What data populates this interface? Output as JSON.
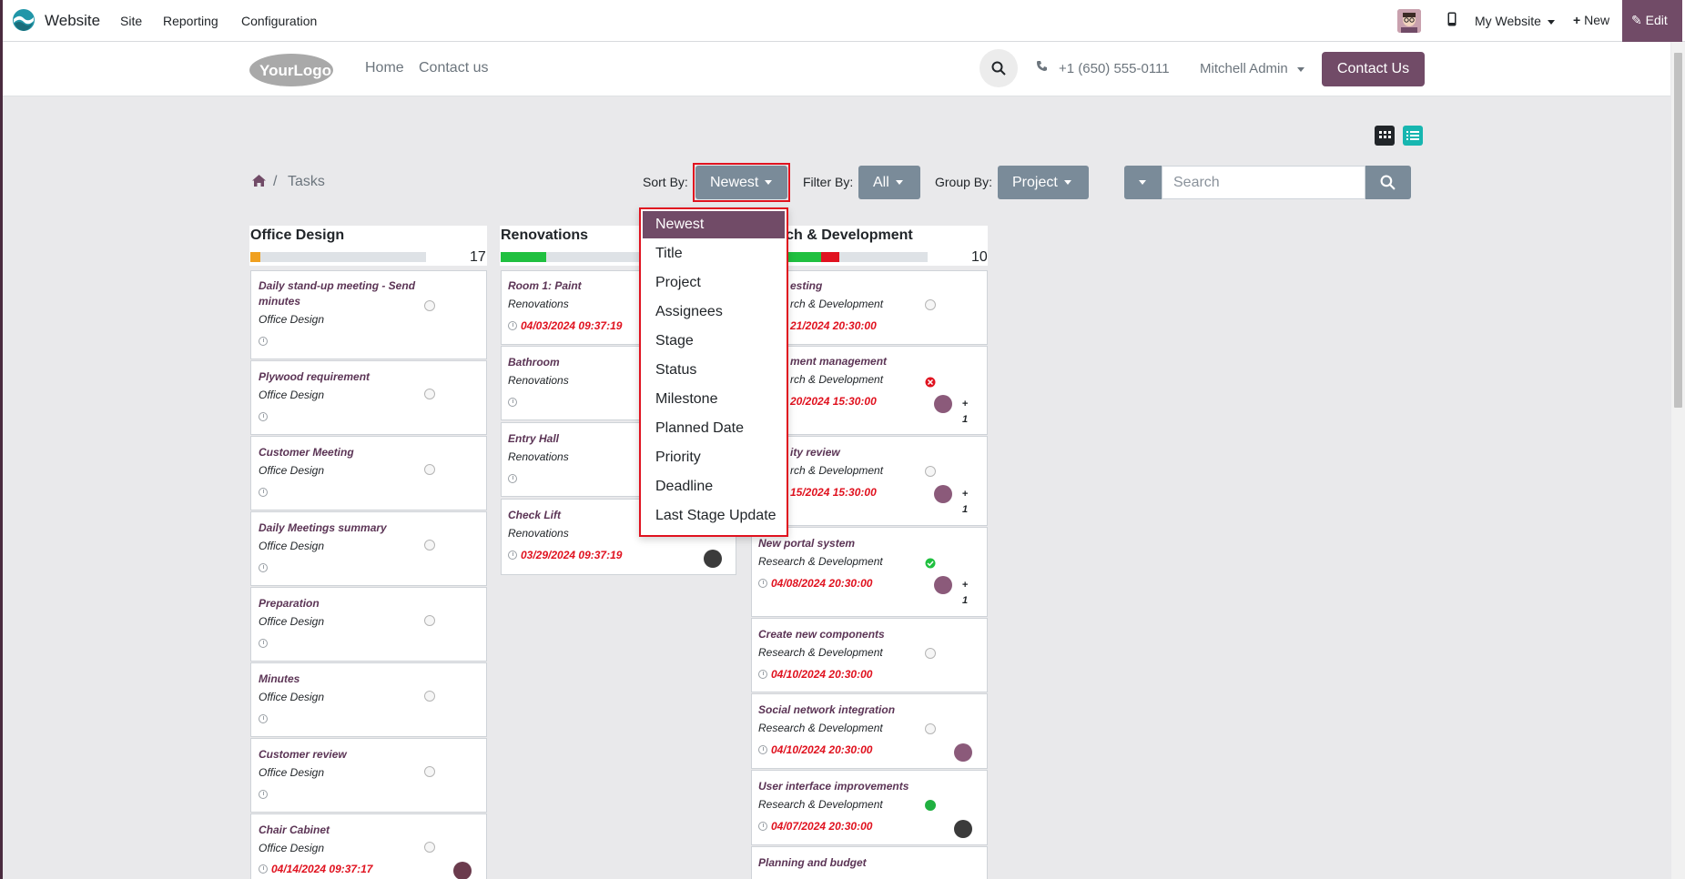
{
  "topbar": {
    "app_name": "Website",
    "menu": [
      "Site",
      "Reporting",
      "Configuration"
    ],
    "my_website": "My Website",
    "new_label": "New",
    "edit_label": "Edit"
  },
  "site_header": {
    "logo_text": "YourLogo",
    "nav": [
      "Home",
      "Contact us"
    ],
    "phone": "+1 (650) 555-0111",
    "user": "Mitchell Admin",
    "contact_button": "Contact Us"
  },
  "breadcrumb": {
    "separator": "/",
    "current": "Tasks"
  },
  "controls": {
    "sort_label": "Sort By:",
    "sort_value": "Newest",
    "filter_label": "Filter By:",
    "filter_value": "All",
    "group_label": "Group By:",
    "group_value": "Project",
    "search_placeholder": "Search"
  },
  "sort_options": [
    "Newest",
    "Title",
    "Project",
    "Assignees",
    "Stage",
    "Status",
    "Milestone",
    "Planned Date",
    "Priority",
    "Deadline",
    "Last Stage Update"
  ],
  "columns": [
    {
      "title": "Office Design",
      "count": "17",
      "cards": [
        {
          "title": "Daily stand-up meeting - Send minutes",
          "project": "Office Design",
          "date": ""
        },
        {
          "title": "Plywood requirement",
          "project": "Office Design",
          "date": ""
        },
        {
          "title": "Customer Meeting",
          "project": "Office Design",
          "date": ""
        },
        {
          "title": "Daily Meetings summary",
          "project": "Office Design",
          "date": ""
        },
        {
          "title": "Preparation",
          "project": "Office Design",
          "date": ""
        },
        {
          "title": "Minutes",
          "project": "Office Design",
          "date": ""
        },
        {
          "title": "Customer review",
          "project": "Office Design",
          "date": ""
        },
        {
          "title": "Chair Cabinet",
          "project": "Office Design",
          "date": "04/14/2024 09:37:17"
        }
      ]
    },
    {
      "title": "Renovations",
      "count": "",
      "cards": [
        {
          "title": "Room 1: Paint",
          "project": "Renovations",
          "date": "04/03/2024 09:37:19"
        },
        {
          "title": "Bathroom",
          "project": "Renovations",
          "date": ""
        },
        {
          "title": "Entry Hall",
          "project": "Renovations",
          "date": ""
        },
        {
          "title": "Check Lift",
          "project": "Renovations",
          "date": "03/29/2024 09:37:19"
        }
      ]
    },
    {
      "title": "arch & Development",
      "count": "10",
      "cards": [
        {
          "title": "esting",
          "project": "rch & Development",
          "date": "21/2024 20:30:00"
        },
        {
          "title": "ment management",
          "project": "rch & Development",
          "date": "20/2024 15:30:00",
          "extra": [
            "+",
            "1"
          ]
        },
        {
          "title": "ity review",
          "project": "rch & Development",
          "date": "15/2024 15:30:00",
          "extra": [
            "+",
            "1"
          ]
        },
        {
          "title": "New portal system",
          "project": "Research & Development",
          "date": "04/08/2024 20:30:00",
          "extra": [
            "+",
            "1"
          ]
        },
        {
          "title": "Create new components",
          "project": "Research & Development",
          "date": "04/10/2024 20:30:00"
        },
        {
          "title": "Social network integration",
          "project": "Research & Development",
          "date": "04/10/2024 20:30:00"
        },
        {
          "title": "User interface improvements",
          "project": "Research & Development",
          "date": "04/07/2024 20:30:00"
        },
        {
          "title": "Planning and budget",
          "project": "",
          "date": ""
        }
      ]
    }
  ],
  "colors": {
    "brand": "#714b67",
    "button_gray": "#7a8b99",
    "deadline_red": "#e0121f",
    "highlight_red": "#e0121f",
    "progress_green": "#20c040",
    "progress_orange": "#f0a020"
  }
}
